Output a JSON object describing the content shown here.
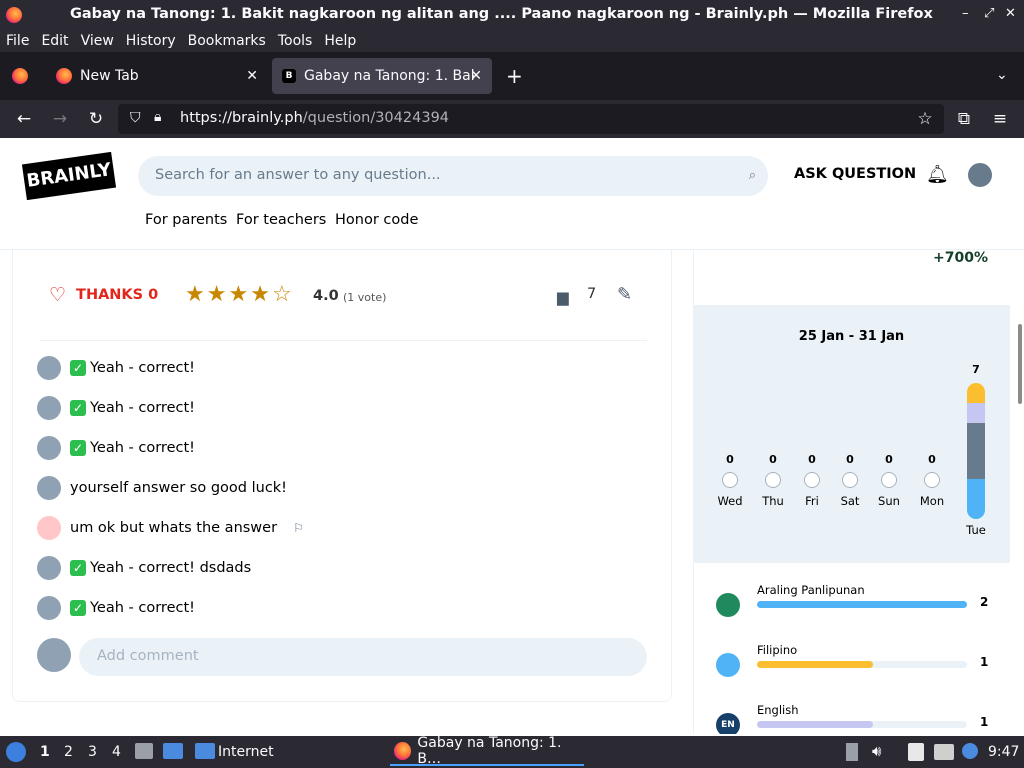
{
  "window": {
    "title": "Gabay na Tanong: 1. Bakit nagkaroon ng alitan ang .... Paano nagkaroon ng - Brainly.ph — Mozilla Firefox",
    "controls": [
      "–",
      "⤢",
      "✕"
    ]
  },
  "menu": [
    "File",
    "Edit",
    "View",
    "History",
    "Bookmarks",
    "Tools",
    "Help"
  ],
  "tabs": [
    {
      "label": "New Tab",
      "active": false
    },
    {
      "label": "Gabay na Tanong: 1. Bak",
      "active": true
    }
  ],
  "new_tab_symbol": "+",
  "url": {
    "host": "https://brainly.ph",
    "path": "/question/30424394"
  },
  "header": {
    "logo_text": "BRAINLY",
    "search_placeholder": "Search for an answer to any question...",
    "ask_label": "ASK QUESTION",
    "nav": [
      "For parents",
      "For teachers",
      "Honor code"
    ]
  },
  "answer": {
    "thanks_label": "THANKS 0",
    "stars_filled": 4,
    "stars_total": 5,
    "rating": "4.0",
    "votes": "(1 vote)",
    "comment_count": "7"
  },
  "comments": [
    {
      "text": "Yeah - correct!",
      "check": true,
      "flag": false
    },
    {
      "text": "Yeah - correct!",
      "check": true,
      "flag": false
    },
    {
      "text": "Yeah - correct!",
      "check": true,
      "flag": false
    },
    {
      "text": "yourself answer so good luck!",
      "check": false,
      "flag": false
    },
    {
      "text": "um ok but whats the answer",
      "check": false,
      "flag": true
    },
    {
      "text": "Yeah - correct! dsdads",
      "check": true,
      "flag": false
    },
    {
      "text": "Yeah - correct!",
      "check": true,
      "flag": false
    }
  ],
  "add_comment_placeholder": "Add comment",
  "stats": {
    "growth": "+700%",
    "date_range": "25 Jan - 31 Jan",
    "days": [
      {
        "label": "Wed",
        "count": "0"
      },
      {
        "label": "Thu",
        "count": "0"
      },
      {
        "label": "Fri",
        "count": "0"
      },
      {
        "label": "Sat",
        "count": "0"
      },
      {
        "label": "Sun",
        "count": "0"
      },
      {
        "label": "Mon",
        "count": "0"
      },
      {
        "label": "Tue",
        "count": "7"
      }
    ]
  },
  "subjects": [
    {
      "name": "Araling Panlipunan",
      "value": "2",
      "fraction": 1.0,
      "color": "#4fb3f6"
    },
    {
      "name": "Filipino",
      "value": "1",
      "fraction": 0.55,
      "color": "#fbbe2e"
    },
    {
      "name": "English",
      "value": "1",
      "fraction": 0.55,
      "color": "#c6c6f2"
    }
  ],
  "taskbar": {
    "workspaces": [
      "1",
      "2",
      "3",
      "4"
    ],
    "app_label": "Internet",
    "window_label": "Gabay na Tanong: 1. B…",
    "clock": "9:47"
  }
}
